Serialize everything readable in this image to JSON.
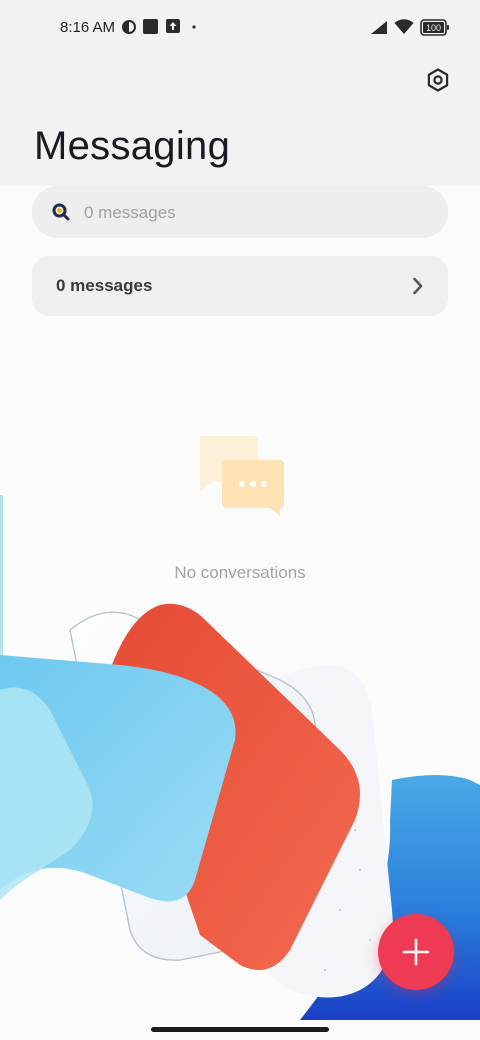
{
  "status_bar": {
    "time": "8:16 AM",
    "battery": "100",
    "icons": [
      "vpn-key-icon",
      "square-app-icon",
      "upload-icon",
      "dot-icon",
      "signal-icon",
      "wifi-icon",
      "battery-icon"
    ]
  },
  "header": {
    "title": "Messaging",
    "settings_icon": "settings-gear-icon"
  },
  "search": {
    "placeholder": "0 messages",
    "icon": "search-icon"
  },
  "messages_row": {
    "label": "0 messages",
    "icon": "chevron-right-icon"
  },
  "empty_state": {
    "text": "No conversations",
    "icon": "chat-bubbles-icon"
  },
  "fab": {
    "icon": "plus-icon",
    "color": "#ee3a52"
  },
  "colors": {
    "background": "#fbfbfb",
    "header_bg": "#f2f2f2",
    "accent": "#ee3a52"
  }
}
